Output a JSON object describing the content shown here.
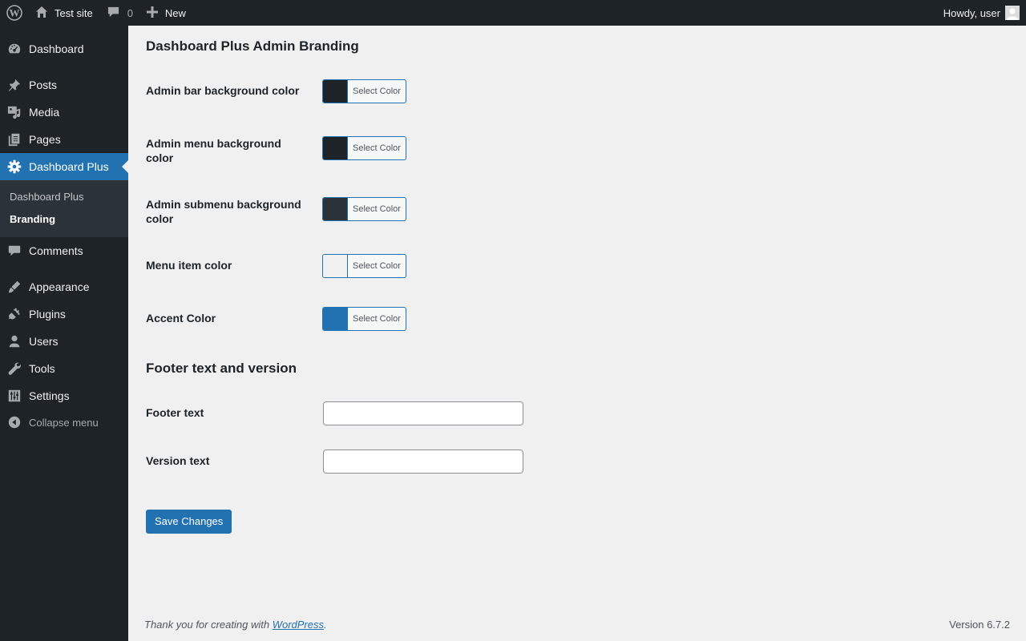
{
  "adminbar": {
    "site_name": "Test site",
    "comments_count": "0",
    "new_label": "New",
    "greeting": "Howdy, user"
  },
  "sidebar": {
    "items": [
      {
        "label": "Dashboard",
        "icon": "dashboard-icon"
      },
      {
        "label": "Posts",
        "icon": "pin-icon"
      },
      {
        "label": "Media",
        "icon": "media-icon"
      },
      {
        "label": "Pages",
        "icon": "pages-icon"
      },
      {
        "label": "Dashboard Plus",
        "icon": "gear-icon"
      },
      {
        "label": "Comments",
        "icon": "comment-icon"
      },
      {
        "label": "Appearance",
        "icon": "brush-icon"
      },
      {
        "label": "Plugins",
        "icon": "plugin-icon"
      },
      {
        "label": "Users",
        "icon": "user-icon"
      },
      {
        "label": "Tools",
        "icon": "wrench-icon"
      },
      {
        "label": "Settings",
        "icon": "settings-icon"
      }
    ],
    "submenu": [
      {
        "label": "Dashboard Plus"
      },
      {
        "label": "Branding"
      }
    ],
    "collapse_label": "Collapse menu"
  },
  "main": {
    "title": "Dashboard Plus Admin Branding",
    "color_fields": [
      {
        "label": "Admin bar background color",
        "button": "Select Color",
        "color": "#1d2327"
      },
      {
        "label": "Admin menu background color",
        "button": "Select Color",
        "color": "#1d2327"
      },
      {
        "label": "Admin submenu background color",
        "button": "Select Color",
        "color": "#2c3338"
      },
      {
        "label": "Menu item color",
        "button": "Select Color",
        "color": "#f0f0f1"
      },
      {
        "label": "Accent Color",
        "button": "Select Color",
        "color": "#2271b1"
      }
    ],
    "footer_section_title": "Footer text and version",
    "text_fields": [
      {
        "label": "Footer text",
        "value": ""
      },
      {
        "label": "Version text",
        "value": ""
      }
    ],
    "save_label": "Save Changes"
  },
  "footer": {
    "thanks_prefix": "Thank you for creating with ",
    "link_text": "WordPress",
    "thanks_suffix": ".",
    "version": "Version 6.7.2"
  },
  "colors": {
    "accent": "#2271b1",
    "admin_bar": "#1d2327",
    "submenu": "#2c3338"
  }
}
